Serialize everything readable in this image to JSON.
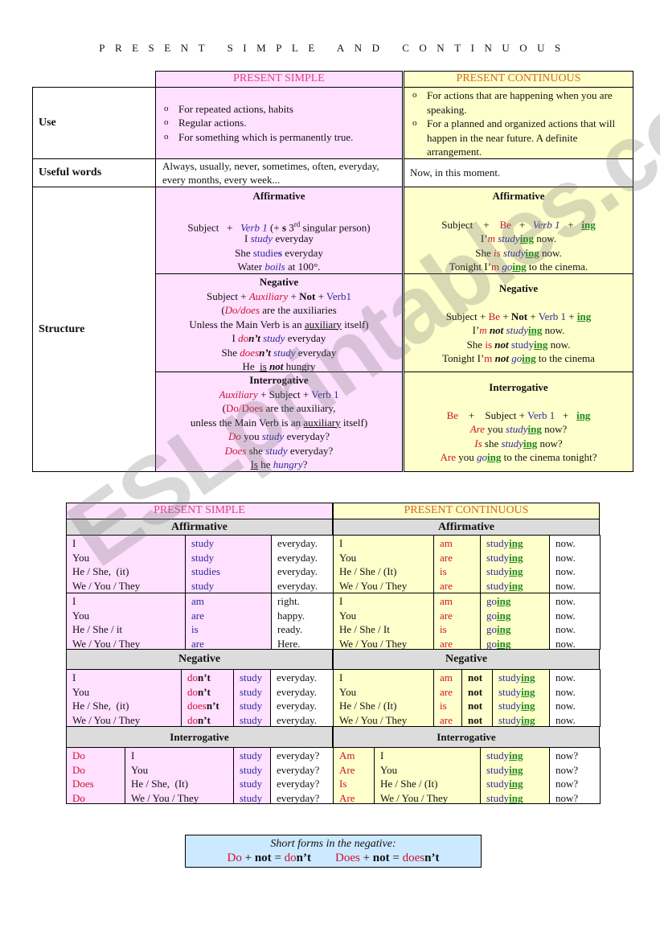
{
  "title": "PRESENT SIMPLE AND CONTINUOUS",
  "watermark": "ESLprintables.com",
  "colors": {
    "pink": "#ffe0ff",
    "yellow": "#ffffcc",
    "gray": "#dcdcdc",
    "red": "#cc1133",
    "blue": "#2b2b99",
    "green": "#1d8a1d",
    "ps_header": "#e0408a",
    "pc_header": "#d2691e",
    "box": "#cde9ff"
  },
  "top": {
    "ps_header": "PRESENT SIMPLE",
    "pc_header": "PRESENT CONTINUOUS",
    "use_label": "Use",
    "useful_label": "Useful words",
    "structure_label": "Structure",
    "use_ps": [
      "For repeated actions, habits",
      "Regular actions.",
      "For something which is permanently true."
    ],
    "use_pc": [
      "For actions that are happening when you are speaking.",
      "For a planned and organized actions that will happen in the near future. A definite arrangement."
    ],
    "useful_ps": "Always, usually, never, sometimes, often, everyday, every months, every week...",
    "useful_pc": "Now, in this moment.",
    "aff_label": "Affirmative",
    "neg_label": "Negative",
    "int_label": "Interrogative",
    "aff_ps": [
      [
        [
          "Subject   +   ",
          ""
        ],
        [
          "Verb 1",
          "bi"
        ],
        [
          " (+ ",
          ""
        ],
        [
          "s",
          "B"
        ],
        [
          " 3",
          ""
        ],
        [
          "rd",
          "sup"
        ],
        [
          " singular person)",
          ""
        ]
      ],
      [
        [
          "I ",
          ""
        ],
        [
          "study",
          "bi"
        ],
        [
          " everyday",
          ""
        ]
      ],
      [
        [
          "She ",
          ""
        ],
        [
          "studie",
          "b"
        ],
        [
          "s",
          "bB"
        ],
        [
          " everyday",
          ""
        ]
      ],
      [
        [
          "Water ",
          ""
        ],
        [
          "boils",
          "bi"
        ],
        [
          " at 100°.",
          ""
        ]
      ]
    ],
    "aff_pc": [
      [
        [
          "Subject    +    ",
          ""
        ],
        [
          "Be",
          "r"
        ],
        [
          "   +   ",
          ""
        ],
        [
          "Verb 1",
          "bi"
        ],
        [
          "   +   ",
          ""
        ],
        [
          "ing",
          "g"
        ]
      ],
      [
        [
          "I’",
          ""
        ],
        [
          "m",
          "ri"
        ],
        [
          " ",
          ""
        ],
        [
          "study",
          "bi"
        ],
        [
          "ing",
          "g"
        ],
        [
          " now.",
          ""
        ]
      ],
      [
        [
          "She ",
          ""
        ],
        [
          "is",
          "ri"
        ],
        [
          " ",
          ""
        ],
        [
          "study",
          "bi"
        ],
        [
          "ing",
          "g"
        ],
        [
          " now.",
          ""
        ]
      ],
      [
        [
          "Tonight I’",
          ""
        ],
        [
          "m",
          "r"
        ],
        [
          " ",
          ""
        ],
        [
          "go",
          "bi"
        ],
        [
          "ing",
          "g"
        ],
        [
          " to the cinema.",
          ""
        ]
      ]
    ],
    "neg_ps": [
      [
        [
          "Subject + ",
          ""
        ],
        [
          "Auxiliary",
          "ri"
        ],
        [
          " + ",
          ""
        ],
        [
          "Not",
          "B"
        ],
        [
          " + ",
          ""
        ],
        [
          "Verb1",
          "b"
        ]
      ],
      [
        [
          "(",
          ""
        ],
        [
          "Do/does",
          "ri"
        ],
        [
          " are the auxiliaries",
          ""
        ]
      ],
      [
        [
          "Unless the Main Verb is an ",
          ""
        ],
        [
          "auxiliary",
          "u"
        ],
        [
          " itself)",
          ""
        ]
      ],
      [
        [
          "I ",
          ""
        ],
        [
          "do",
          "ri"
        ],
        [
          "n’t",
          "Bi"
        ],
        [
          " ",
          ""
        ],
        [
          "study",
          "bi"
        ],
        [
          " everyday",
          ""
        ]
      ],
      [
        [
          "She ",
          ""
        ],
        [
          "does",
          "ri"
        ],
        [
          "n’t",
          "Bi"
        ],
        [
          " ",
          ""
        ],
        [
          "study",
          "bi"
        ],
        [
          " everyday",
          ""
        ]
      ],
      [
        [
          "He  ",
          ""
        ],
        [
          "is",
          "u"
        ],
        [
          " ",
          ""
        ],
        [
          "not",
          "Bi"
        ],
        [
          " hungry",
          ""
        ]
      ]
    ],
    "neg_pc": [
      [
        [
          "Subject + ",
          ""
        ],
        [
          "Be",
          "r"
        ],
        [
          " + ",
          ""
        ],
        [
          "Not",
          "B"
        ],
        [
          " + ",
          ""
        ],
        [
          "Verb 1",
          "b"
        ],
        [
          " + ",
          ""
        ],
        [
          "ing",
          "g"
        ]
      ],
      [
        [
          "I’",
          ""
        ],
        [
          "m",
          "ri"
        ],
        [
          " ",
          ""
        ],
        [
          "not",
          "Bi"
        ],
        [
          " ",
          ""
        ],
        [
          "study",
          "bi"
        ],
        [
          "ing",
          "g"
        ],
        [
          " now.",
          ""
        ]
      ],
      [
        [
          "She ",
          ""
        ],
        [
          "is",
          "r"
        ],
        [
          " ",
          ""
        ],
        [
          "not",
          "Bi"
        ],
        [
          " ",
          ""
        ],
        [
          "study",
          "b"
        ],
        [
          "ing",
          "g"
        ],
        [
          " now.",
          ""
        ]
      ],
      [
        [
          "Tonight I’",
          ""
        ],
        [
          "m",
          "r"
        ],
        [
          " ",
          ""
        ],
        [
          "not",
          "Bi"
        ],
        [
          " ",
          ""
        ],
        [
          "go",
          "bi"
        ],
        [
          "ing",
          "g"
        ],
        [
          " to the cinema",
          ""
        ]
      ]
    ],
    "int_ps": [
      [
        [
          "Auxiliary",
          "ri"
        ],
        [
          " + Subject + ",
          ""
        ],
        [
          "Verb 1",
          "b"
        ]
      ],
      [
        [
          "(",
          ""
        ],
        [
          "Do/Does",
          "r"
        ],
        [
          " are the auxiliary,",
          ""
        ]
      ],
      [
        [
          "unless the Main Verb is an ",
          ""
        ],
        [
          "auxiliary",
          "u"
        ],
        [
          " itself)",
          ""
        ]
      ],
      [
        [
          "Do",
          "ri"
        ],
        [
          " you ",
          ""
        ],
        [
          "study",
          "bi"
        ],
        [
          " everyday?",
          ""
        ]
      ],
      [
        [
          "Does",
          "ri"
        ],
        [
          " she ",
          ""
        ],
        [
          "study",
          "bi"
        ],
        [
          " everyday?",
          ""
        ]
      ],
      [
        [
          "Is",
          "u"
        ],
        [
          " he ",
          ""
        ],
        [
          "hungry",
          "bi"
        ],
        [
          "?",
          ""
        ]
      ]
    ],
    "int_pc": [
      [
        [
          "Be",
          "r"
        ],
        [
          "    +    Subject + ",
          ""
        ],
        [
          "Verb 1",
          "b"
        ],
        [
          "   +   ",
          ""
        ],
        [
          "ing",
          "g"
        ]
      ],
      [
        [
          "Are",
          "ri"
        ],
        [
          " you ",
          ""
        ],
        [
          "study",
          "bi"
        ],
        [
          "ing",
          "g"
        ],
        [
          " now?",
          ""
        ]
      ],
      [
        [
          "Is",
          "ri"
        ],
        [
          " she ",
          ""
        ],
        [
          "study",
          "bi"
        ],
        [
          "ing",
          "g"
        ],
        [
          " now?",
          ""
        ]
      ],
      [
        [
          "Are",
          "r"
        ],
        [
          " you ",
          ""
        ],
        [
          "go",
          "bi"
        ],
        [
          "ing",
          "g"
        ],
        [
          " to the cinema tonight?",
          ""
        ]
      ]
    ]
  },
  "table2": {
    "ps_header": "PRESENT SIMPLE",
    "pc_header": "PRESENT CONTINUOUS",
    "aff_label": "Affirmative",
    "neg_label": "Negative",
    "int_label": "Interrogative",
    "ps_aff1": [
      [
        "I",
        "study",
        "everyday."
      ],
      [
        "You",
        "study",
        "everyday."
      ],
      [
        "He / She,  (it)",
        "studies",
        "everyday."
      ],
      [
        "We / You / They",
        "study",
        "everyday."
      ]
    ],
    "ps_aff2": [
      [
        "I",
        "am",
        "right."
      ],
      [
        "You",
        "are",
        "happy."
      ],
      [
        "He / She / it",
        "is",
        "ready."
      ],
      [
        "We / You / They",
        "are",
        "Here."
      ]
    ],
    "ps_neg": [
      [
        "I",
        [
          [
            "do",
            "r"
          ],
          [
            "n’t",
            "B"
          ]
        ],
        "study",
        "everyday."
      ],
      [
        "You",
        [
          [
            "do",
            "r"
          ],
          [
            "n’t",
            "B"
          ]
        ],
        "study",
        "everyday."
      ],
      [
        "He / She,  (it)",
        [
          [
            "does",
            "r"
          ],
          [
            "n’t",
            "B"
          ]
        ],
        "study",
        "everyday."
      ],
      [
        "We / You / They",
        [
          [
            "do",
            "r"
          ],
          [
            "n’t",
            "B"
          ]
        ],
        "study",
        "everyday."
      ]
    ],
    "ps_int": [
      [
        "Do",
        "I",
        "study",
        "everyday?"
      ],
      [
        "Do",
        "You",
        "study",
        "everyday?"
      ],
      [
        "Does",
        "He / She,  (It)",
        "study",
        "everyday?"
      ],
      [
        "Do",
        "We / You / They",
        "study",
        "everyday?"
      ]
    ],
    "pc_aff1": [
      [
        "I",
        "am",
        [
          [
            "study",
            "b"
          ],
          [
            "ing",
            "g"
          ]
        ],
        "now."
      ],
      [
        "You",
        "are",
        [
          [
            "study",
            "b"
          ],
          [
            "ing",
            "g"
          ]
        ],
        "now."
      ],
      [
        "He / She / (It)",
        "is",
        [
          [
            "study",
            "b"
          ],
          [
            "ing",
            "g"
          ]
        ],
        "now."
      ],
      [
        "We / You / They",
        "are",
        [
          [
            "study",
            "b"
          ],
          [
            "ing",
            "g"
          ]
        ],
        "now."
      ]
    ],
    "pc_aff2": [
      [
        "I",
        "am",
        [
          [
            "go",
            "b"
          ],
          [
            "ing",
            "g"
          ]
        ],
        "now."
      ],
      [
        "You",
        "are",
        [
          [
            "go",
            "b"
          ],
          [
            "ing",
            "g"
          ]
        ],
        "now."
      ],
      [
        "He / She / It",
        "is",
        [
          [
            "go",
            "b"
          ],
          [
            "ing",
            "g"
          ]
        ],
        "now."
      ],
      [
        "We / You / They",
        "are",
        [
          [
            "go",
            "b"
          ],
          [
            "ing",
            "g"
          ]
        ],
        "now."
      ]
    ],
    "pc_neg": [
      [
        "I",
        "am",
        "not",
        [
          [
            "study",
            "b"
          ],
          [
            "ing",
            "g"
          ]
        ],
        "now."
      ],
      [
        "You",
        "are",
        "not",
        [
          [
            "study",
            "b"
          ],
          [
            "ing",
            "g"
          ]
        ],
        "now."
      ],
      [
        "He / She / (It)",
        "is",
        "not",
        [
          [
            "study",
            "b"
          ],
          [
            "ing",
            "g"
          ]
        ],
        "now."
      ],
      [
        "We / You / They",
        "are",
        "not",
        [
          [
            "study",
            "b"
          ],
          [
            "ing",
            "g"
          ]
        ],
        "now."
      ]
    ],
    "pc_int": [
      [
        "Am",
        "I",
        [
          [
            "study",
            "b"
          ],
          [
            "ing",
            "g"
          ]
        ],
        "now?"
      ],
      [
        "Are",
        "You",
        [
          [
            "study",
            "b"
          ],
          [
            "ing",
            "g"
          ]
        ],
        "now?"
      ],
      [
        "Is",
        "He / She / (It)",
        [
          [
            "study",
            "b"
          ],
          [
            "ing",
            "g"
          ]
        ],
        "now?"
      ],
      [
        "Are",
        "We / You / They",
        [
          [
            "study",
            "b"
          ],
          [
            "ing",
            "g"
          ]
        ],
        "now?"
      ]
    ]
  },
  "box": {
    "title": "Short forms in the negative:",
    "line": [
      [
        "Do",
        "r"
      ],
      [
        " + ",
        ""
      ],
      [
        "not",
        "B"
      ],
      [
        " = ",
        ""
      ],
      [
        "do",
        "r"
      ],
      [
        "n’t",
        "B"
      ],
      [
        "        ",
        ""
      ],
      [
        "Does",
        "r"
      ],
      [
        " + ",
        ""
      ],
      [
        "not",
        "B"
      ],
      [
        " = ",
        ""
      ],
      [
        "does",
        "r"
      ],
      [
        "n’t",
        "B"
      ]
    ]
  }
}
